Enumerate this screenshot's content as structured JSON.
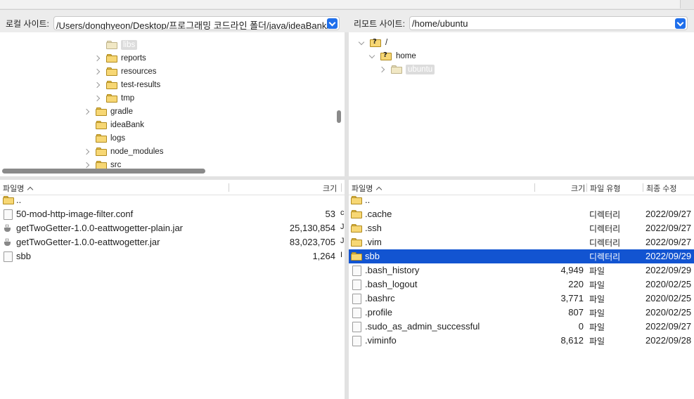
{
  "local": {
    "label": "로컬 사이트:",
    "path": "/Users/donghyeon/Desktop/프로그래밍 코드라인 폴더/java/ideaBank/",
    "tree": [
      {
        "name": "libs",
        "indent": 3,
        "chevron": "none",
        "selected": true
      },
      {
        "name": "reports",
        "indent": 3,
        "chevron": "right"
      },
      {
        "name": "resources",
        "indent": 3,
        "chevron": "right"
      },
      {
        "name": "test-results",
        "indent": 3,
        "chevron": "right"
      },
      {
        "name": "tmp",
        "indent": 3,
        "chevron": "right"
      },
      {
        "name": "gradle",
        "indent": 2,
        "chevron": "right"
      },
      {
        "name": "ideaBank",
        "indent": 2,
        "chevron": "none"
      },
      {
        "name": "logs",
        "indent": 2,
        "chevron": "none"
      },
      {
        "name": "node_modules",
        "indent": 2,
        "chevron": "right"
      },
      {
        "name": "src",
        "indent": 2,
        "chevron": "right"
      }
    ],
    "columns": {
      "name": "파일명",
      "size": "크기"
    },
    "files": [
      {
        "name": "..",
        "size": "",
        "type": "folder",
        "extra": ""
      },
      {
        "name": "50-mod-http-image-filter.conf",
        "size": "53",
        "type": "file",
        "extra": "c"
      },
      {
        "name": "getTwoGetter-1.0.0-eattwogetter-plain.jar",
        "size": "25,130,854",
        "type": "jar",
        "extra": "J"
      },
      {
        "name": "getTwoGetter-1.0.0-eattwogetter.jar",
        "size": "83,023,705",
        "type": "jar",
        "extra": "J"
      },
      {
        "name": "sbb",
        "size": "1,264",
        "type": "file",
        "extra": "I"
      }
    ]
  },
  "remote": {
    "label": "리모트 사이트:",
    "path": "/home/ubuntu",
    "tree": [
      {
        "name": "/",
        "indent": 0,
        "chevron": "down",
        "icon": "question-folder"
      },
      {
        "name": "home",
        "indent": 1,
        "chevron": "down",
        "icon": "question-folder"
      },
      {
        "name": "ubuntu",
        "indent": 2,
        "chevron": "right",
        "icon": "folder",
        "selected": true
      }
    ],
    "columns": {
      "name": "파일명",
      "size": "크기",
      "type": "파일 유형",
      "modified": "최종 수정"
    },
    "files": [
      {
        "name": "..",
        "size": "",
        "type": "",
        "modified": "",
        "icon": "folder"
      },
      {
        "name": ".cache",
        "size": "",
        "type": "디렉터리",
        "modified": "2022/09/27",
        "icon": "folder"
      },
      {
        "name": ".ssh",
        "size": "",
        "type": "디렉터리",
        "modified": "2022/09/27",
        "icon": "folder"
      },
      {
        "name": ".vim",
        "size": "",
        "type": "디렉터리",
        "modified": "2022/09/27",
        "icon": "folder"
      },
      {
        "name": "sbb",
        "size": "",
        "type": "디렉터리",
        "modified": "2022/09/29",
        "icon": "folder",
        "selected": true
      },
      {
        "name": ".bash_history",
        "size": "4,949",
        "type": "파일",
        "modified": "2022/09/29",
        "icon": "file"
      },
      {
        "name": ".bash_logout",
        "size": "220",
        "type": "파일",
        "modified": "2020/02/25",
        "icon": "file"
      },
      {
        "name": ".bashrc",
        "size": "3,771",
        "type": "파일",
        "modified": "2020/02/25",
        "icon": "file"
      },
      {
        "name": ".profile",
        "size": "807",
        "type": "파일",
        "modified": "2020/02/25",
        "icon": "file"
      },
      {
        "name": ".sudo_as_admin_successful",
        "size": "0",
        "type": "파일",
        "modified": "2022/09/27",
        "icon": "file"
      },
      {
        "name": ".viminfo",
        "size": "8,612",
        "type": "파일",
        "modified": "2022/09/28",
        "icon": "file"
      }
    ]
  }
}
